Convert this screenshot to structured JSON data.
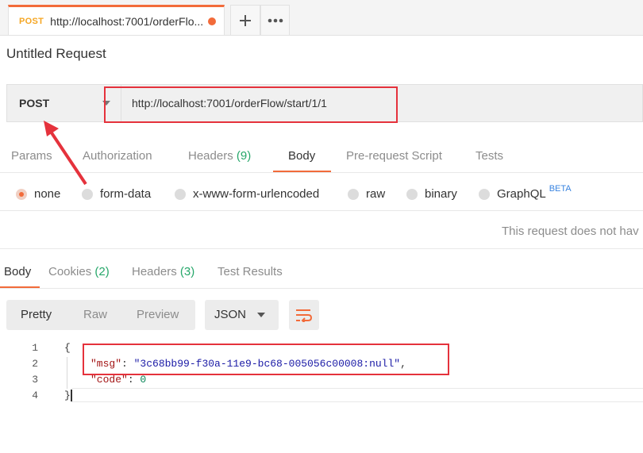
{
  "tabbar": {
    "tab_method": "POST",
    "tab_url": "http://localhost:7001/orderFlo...",
    "plus_icon": "plus",
    "more_icon": "ellipsis"
  },
  "request": {
    "title": "Untitled Request",
    "method": "POST",
    "url": "http://localhost:7001/orderFlow/start/1/1"
  },
  "request_tabs": [
    {
      "label": "Params",
      "count": ""
    },
    {
      "label": "Authorization",
      "count": ""
    },
    {
      "label": "Headers",
      "count": "(9)"
    },
    {
      "label": "Body",
      "count": "",
      "active": true
    },
    {
      "label": "Pre-request Script",
      "count": ""
    },
    {
      "label": "Tests",
      "count": ""
    }
  ],
  "body_types": [
    {
      "label": "none",
      "selected": true
    },
    {
      "label": "form-data"
    },
    {
      "label": "x-www-form-urlencoded"
    },
    {
      "label": "raw"
    },
    {
      "label": "binary"
    },
    {
      "label": "GraphQL",
      "badge": "BETA"
    }
  ],
  "body_message": "This request does not hav",
  "response_tabs": [
    {
      "label": "Body",
      "count": "",
      "active": true
    },
    {
      "label": "Cookies",
      "count": "(2)"
    },
    {
      "label": "Headers",
      "count": "(3)"
    },
    {
      "label": "Test Results",
      "count": ""
    }
  ],
  "view_modes": [
    "Pretty",
    "Raw",
    "Preview"
  ],
  "format": "JSON",
  "response_lines": {
    "numbers": [
      "1",
      "2",
      "3",
      "4"
    ],
    "open_brace": "{",
    "msg_key": "\"msg\"",
    "msg_sep": ": ",
    "msg_value": "\"3c68bb99-f30a-11e9-bc68-005056c00008:null\"",
    "msg_comma": ",",
    "code_key": "\"code\"",
    "code_sep": ": ",
    "code_value": "0",
    "close_brace": "}"
  },
  "colors": {
    "accent": "#f26b3a",
    "method_post": "#f5a623",
    "count_green": "#26a76a",
    "annotation_red": "#e5323c"
  }
}
